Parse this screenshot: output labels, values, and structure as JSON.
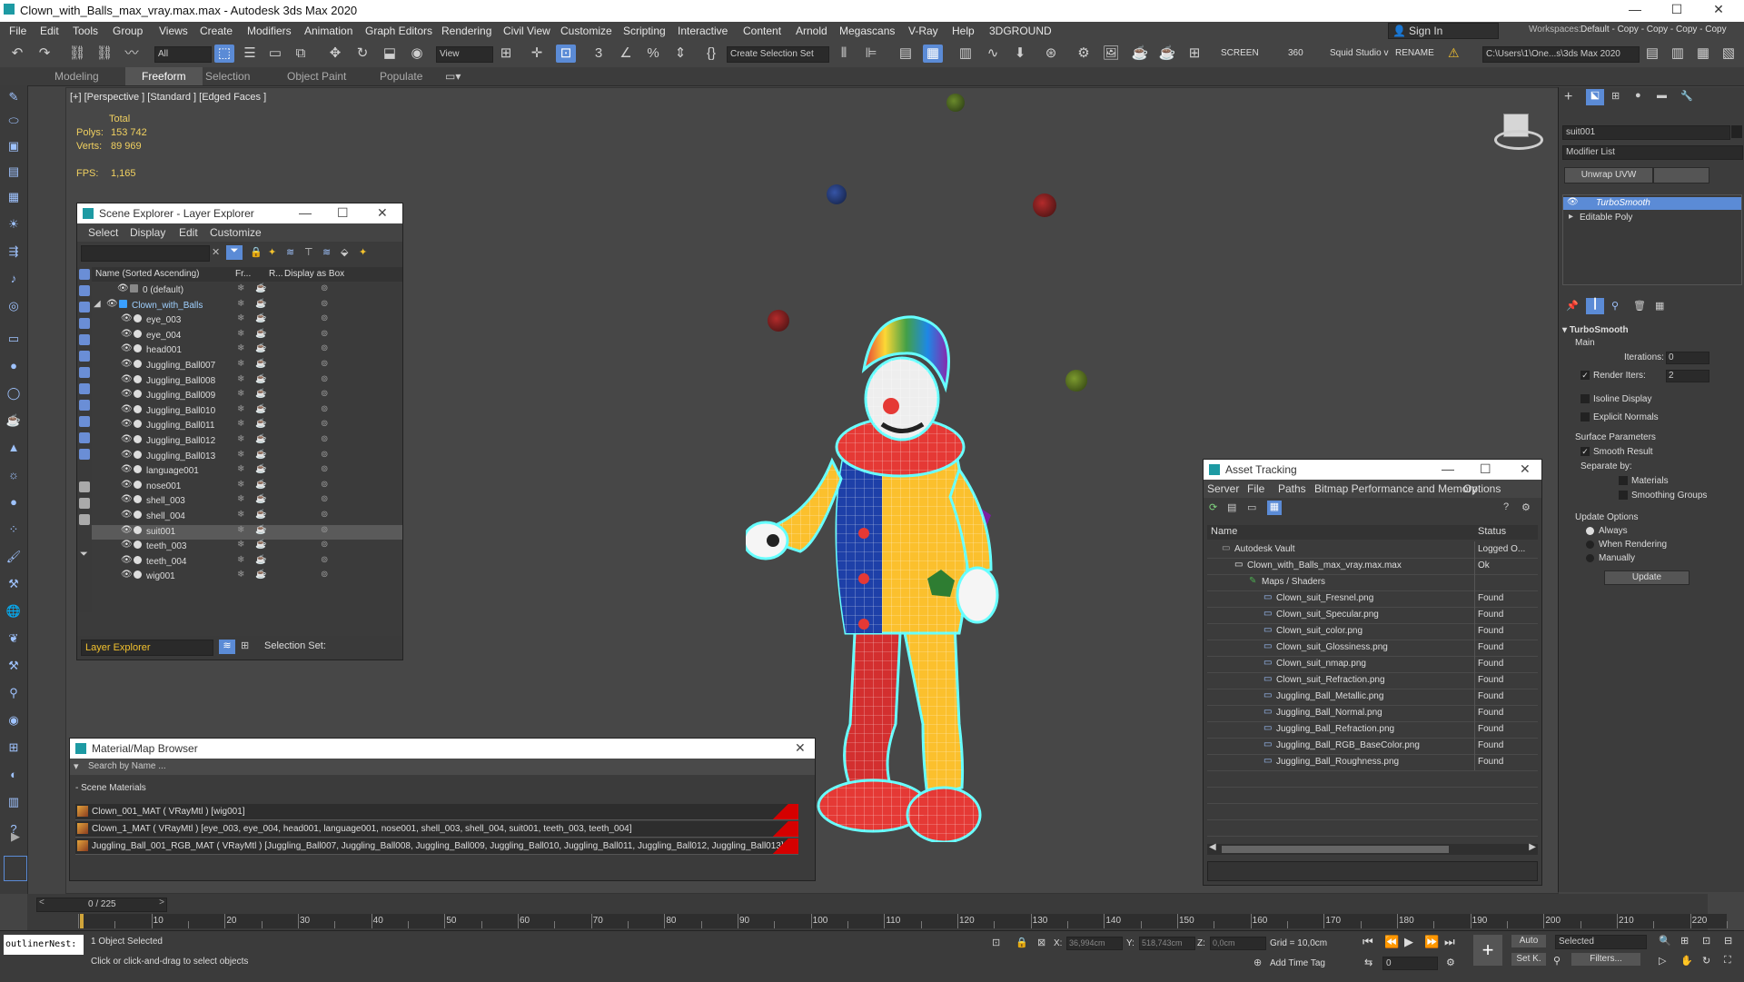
{
  "window": {
    "title": "Clown_with_Balls_max_vray.max.max - Autodesk 3ds Max 2020"
  },
  "menu": [
    "File",
    "Edit",
    "Tools",
    "Group",
    "Views",
    "Create",
    "Modifiers",
    "Animation",
    "Graph Editors",
    "Rendering",
    "Civil View",
    "Customize",
    "Scripting",
    "Interactive",
    "Content",
    "Arnold",
    "Megascans",
    "V-Ray",
    "Help",
    "3DGROUND"
  ],
  "account": {
    "signin": "Sign In",
    "workspaces_label": "Workspaces:",
    "workspace_value": "Default - Copy - Copy - Copy - Copy"
  },
  "toolbar": {
    "filter": "All",
    "view": "View",
    "selection_set": "Create Selection Set",
    "screen": "SCREEN",
    "num": "360",
    "squid": "Squid Studio v",
    "rename": "RENAME",
    "path": "C:\\Users\\1\\One...s\\3ds Max 2020"
  },
  "ribbon": {
    "tabs": [
      "Modeling",
      "Freeform",
      "Selection",
      "Object Paint",
      "Populate"
    ],
    "active": "Freeform"
  },
  "viewport": {
    "label": "[+] [Perspective ] [Standard ] [Edged Faces ]",
    "stats": {
      "total": "Total",
      "polys_label": "Polys:",
      "polys": "153 742",
      "verts_label": "Verts:",
      "verts": "89 969",
      "fps_label": "FPS:",
      "fps": "1,165"
    }
  },
  "scene_explorer": {
    "title": "Scene Explorer - Layer Explorer",
    "menu": [
      "Select",
      "Display",
      "Edit",
      "Customize"
    ],
    "columns": [
      "Name (Sorted Ascending)",
      "Fr...",
      "R...",
      "Display as Box"
    ],
    "rows": [
      "0 (default)",
      "Clown_with_Balls",
      "eye_003",
      "eye_004",
      "head001",
      "Juggling_Ball007",
      "Juggling_Ball008",
      "Juggling_Ball009",
      "Juggling_Ball010",
      "Juggling_Ball011",
      "Juggling_Ball012",
      "Juggling_Ball013",
      "language001",
      "nose001",
      "shell_003",
      "shell_004",
      "suit001",
      "teeth_003",
      "teeth_004",
      "wig001"
    ],
    "footer_combo": "Layer Explorer",
    "footer_label": "Selection Set:"
  },
  "asset_tracking": {
    "title": "Asset Tracking",
    "menu": [
      "Server",
      "File",
      "Paths",
      "Bitmap Performance and Memory",
      "Options"
    ],
    "columns": [
      "Name",
      "Status"
    ],
    "rows": [
      {
        "name": "Autodesk Vault",
        "status": "Logged O..."
      },
      {
        "name": "Clown_with_Balls_max_vray.max.max",
        "status": "Ok"
      },
      {
        "name": "Maps / Shaders",
        "status": ""
      },
      {
        "name": "Clown_suit_Fresnel.png",
        "status": "Found"
      },
      {
        "name": "Clown_suit_Specular.png",
        "status": "Found"
      },
      {
        "name": "Clown_suit_color.png",
        "status": "Found"
      },
      {
        "name": "Clown_suit_Glossiness.png",
        "status": "Found"
      },
      {
        "name": "Clown_suit_nmap.png",
        "status": "Found"
      },
      {
        "name": "Clown_suit_Refraction.png",
        "status": "Found"
      },
      {
        "name": "Juggling_Ball_Metallic.png",
        "status": "Found"
      },
      {
        "name": "Juggling_Ball_Normal.png",
        "status": "Found"
      },
      {
        "name": "Juggling_Ball_Refraction.png",
        "status": "Found"
      },
      {
        "name": "Juggling_Ball_RGB_BaseColor.png",
        "status": "Found"
      },
      {
        "name": "Juggling_Ball_Roughness.png",
        "status": "Found"
      }
    ]
  },
  "material_browser": {
    "title": "Material/Map Browser",
    "search": "Search by Name ...",
    "section": "- Scene Materials",
    "items": [
      "Clown_001_MAT  ( VRayMtl ) [wig001]",
      "Clown_1_MAT  ( VRayMtl ) [eye_003, eye_004, head001, language001, nose001, shell_003, shell_004, suit001, teeth_003, teeth_004]",
      "Juggling_Ball_001_RGB_MAT  ( VRayMtl )  [Juggling_Ball007, Juggling_Ball008, Juggling_Ball009, Juggling_Ball010, Juggling_Ball011, Juggling_Ball012, Juggling_Ball013]"
    ]
  },
  "command_panel": {
    "object_name": "suit001",
    "modifier_list": "Modifier List",
    "unwrap": "Unwrap UVW",
    "stack": [
      "TurboSmooth",
      "Editable Poly"
    ],
    "rollout": "TurboSmooth",
    "main": "Main",
    "iterations_label": "Iterations:",
    "iterations": "0",
    "render_iters_label": "Render Iters:",
    "render_iters": "2",
    "isoline": "Isoline Display",
    "explicit": "Explicit Normals",
    "surface": "Surface Parameters",
    "smooth": "Smooth Result",
    "separate": "Separate by:",
    "materials": "Materials",
    "smoothing": "Smoothing Groups",
    "update_opts": "Update Options",
    "always": "Always",
    "when_rendering": "When Rendering",
    "manually": "Manually",
    "update_btn": "Update"
  },
  "timeline": {
    "frame": "0 / 225",
    "ticks": [
      "10",
      "20",
      "30",
      "40",
      "50",
      "60",
      "70",
      "80",
      "90",
      "100",
      "110",
      "120",
      "130",
      "140",
      "150",
      "160",
      "170",
      "180",
      "190",
      "200",
      "210",
      "220"
    ]
  },
  "status": {
    "script": "outlinerNest:",
    "selected": "1 Object Selected",
    "hint": "Click or click-and-drag to select objects",
    "x_label": "X:",
    "x": "36,994cm",
    "y_label": "Y:",
    "y": "518,743cm",
    "z_label": "Z:",
    "z": "0,0cm",
    "grid": "Grid = 10,0cm",
    "add_time_tag": "Add Time Tag",
    "auto": "Auto",
    "set_k": "Set K.",
    "selected_combo": "Selected",
    "filters": "Filters...",
    "frame_field": "0"
  }
}
